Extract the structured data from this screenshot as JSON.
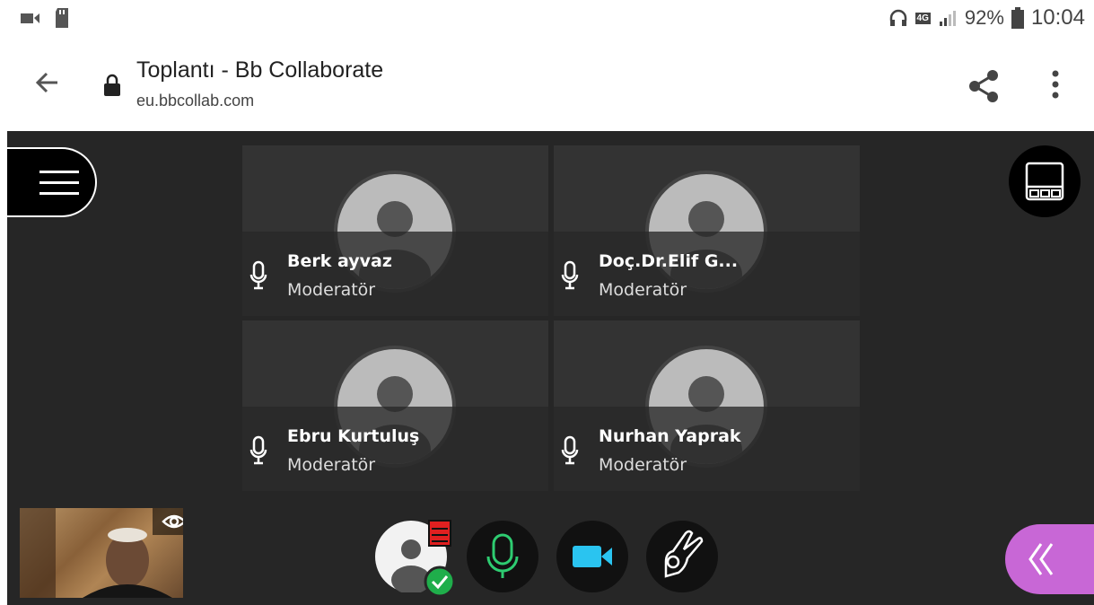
{
  "status_bar": {
    "battery": "92%",
    "time": "10:04",
    "network_badge": "4G",
    "icons": [
      "video-camera-icon",
      "sd-card-icon",
      "headset-icon",
      "signal-icon",
      "battery-icon"
    ]
  },
  "browser": {
    "page_title": "Toplantı - Bb Collaborate",
    "domain": "eu.bbcollab.com"
  },
  "participants": [
    {
      "name": "Berk ayvaz",
      "role": "Moderatör"
    },
    {
      "name": "Doç.Dr.Elif G...",
      "role": "Moderatör"
    },
    {
      "name": "Ebru Kurtuluş",
      "role": "Moderatör"
    },
    {
      "name": "Nurhan Yaprak",
      "role": "Moderatör"
    }
  ],
  "colors": {
    "stage_bg": "#262626",
    "mic_active": "#2ecc71",
    "camera_active": "#2ac4f0",
    "panel_accent": "#c867d6",
    "status_check": "#1fae4b",
    "status_flag": "#e02020"
  }
}
